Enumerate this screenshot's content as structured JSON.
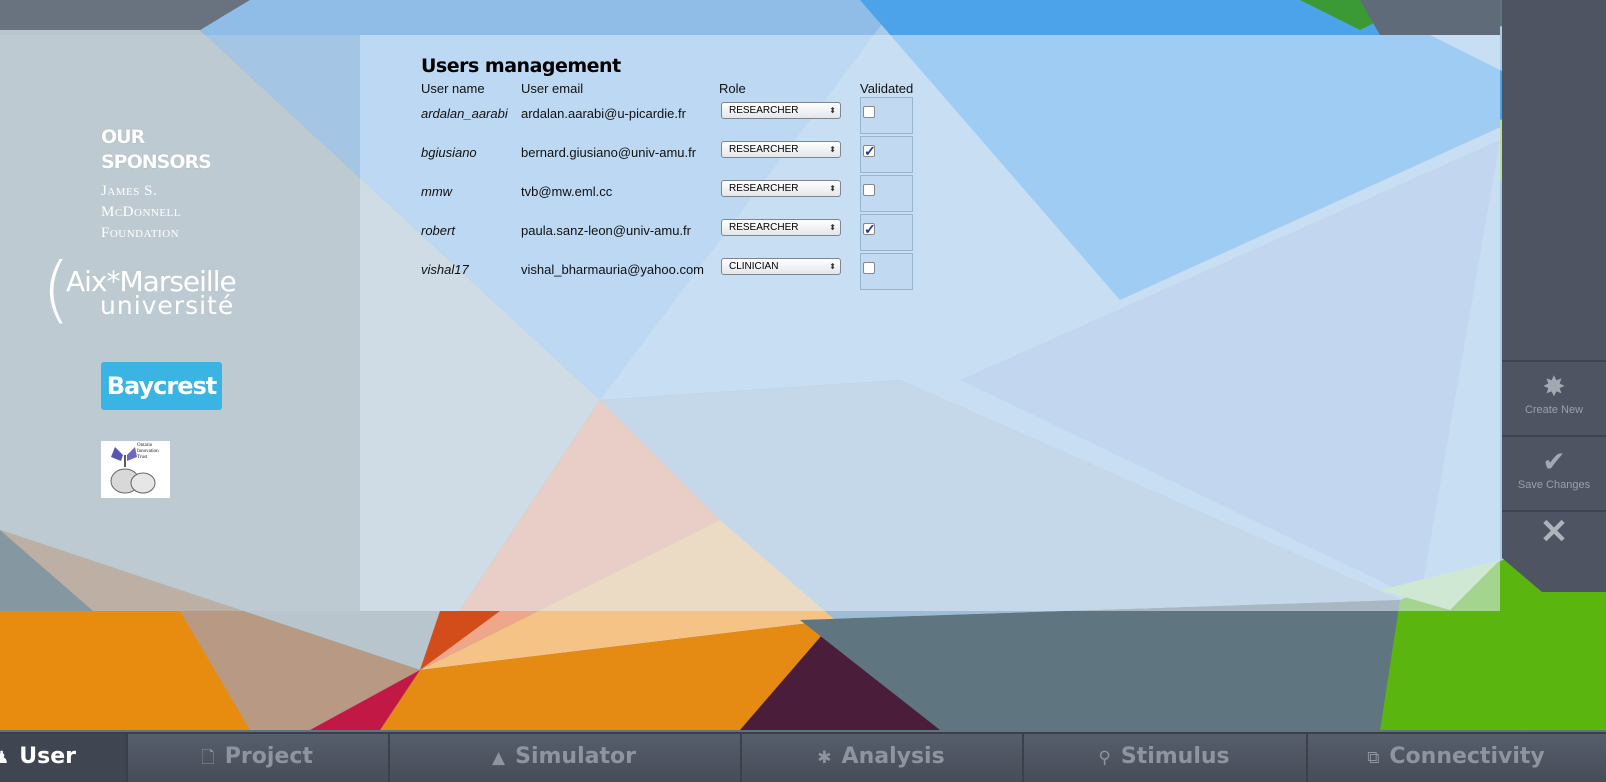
{
  "sponsors": {
    "title_line1": "OUR",
    "title_line2": "SPONSORS",
    "mcdonnell_line1": "James S.",
    "mcdonnell_line2": "McDonnell",
    "mcdonnell_line3": "Foundation",
    "amu_line1": "Aix*Marseille",
    "amu_line2": "université",
    "baycrest": "Baycrest",
    "oit_text": "Ontario Innovation Trust"
  },
  "users_management": {
    "title": "Users management",
    "columns": {
      "name": "User name",
      "email": "User email",
      "role": "Role",
      "validated": "Validated"
    },
    "users": [
      {
        "name": "ardalan_aarabi",
        "email": "ardalan.aarabi@u-picardie.fr",
        "role": "RESEARCHER",
        "validated": false
      },
      {
        "name": "bgiusiano",
        "email": "bernard.giusiano@univ-amu.fr",
        "role": "RESEARCHER",
        "validated": true
      },
      {
        "name": "mmw",
        "email": "tvb@mw.eml.cc",
        "role": "RESEARCHER",
        "validated": false
      },
      {
        "name": "robert",
        "email": "paula.sanz-leon@univ-amu.fr",
        "role": "RESEARCHER",
        "validated": true
      },
      {
        "name": "vishal17",
        "email": "vishal_bharmauria@yahoo.com",
        "role": "CLINICIAN",
        "validated": false
      }
    ]
  },
  "actions": {
    "create_new": "Create New",
    "save_changes": "Save Changes"
  },
  "nav": {
    "tabs": [
      {
        "label": "User",
        "icon": "user-icon",
        "active": true
      },
      {
        "label": "Project",
        "icon": "document-icon",
        "active": false
      },
      {
        "label": "Simulator",
        "icon": "rocket-icon",
        "active": false
      },
      {
        "label": "Analysis",
        "icon": "gear-icon",
        "active": false
      },
      {
        "label": "Stimulus",
        "icon": "pin-icon",
        "active": false
      },
      {
        "label": "Connectivity",
        "icon": "network-icon",
        "active": false
      }
    ]
  }
}
